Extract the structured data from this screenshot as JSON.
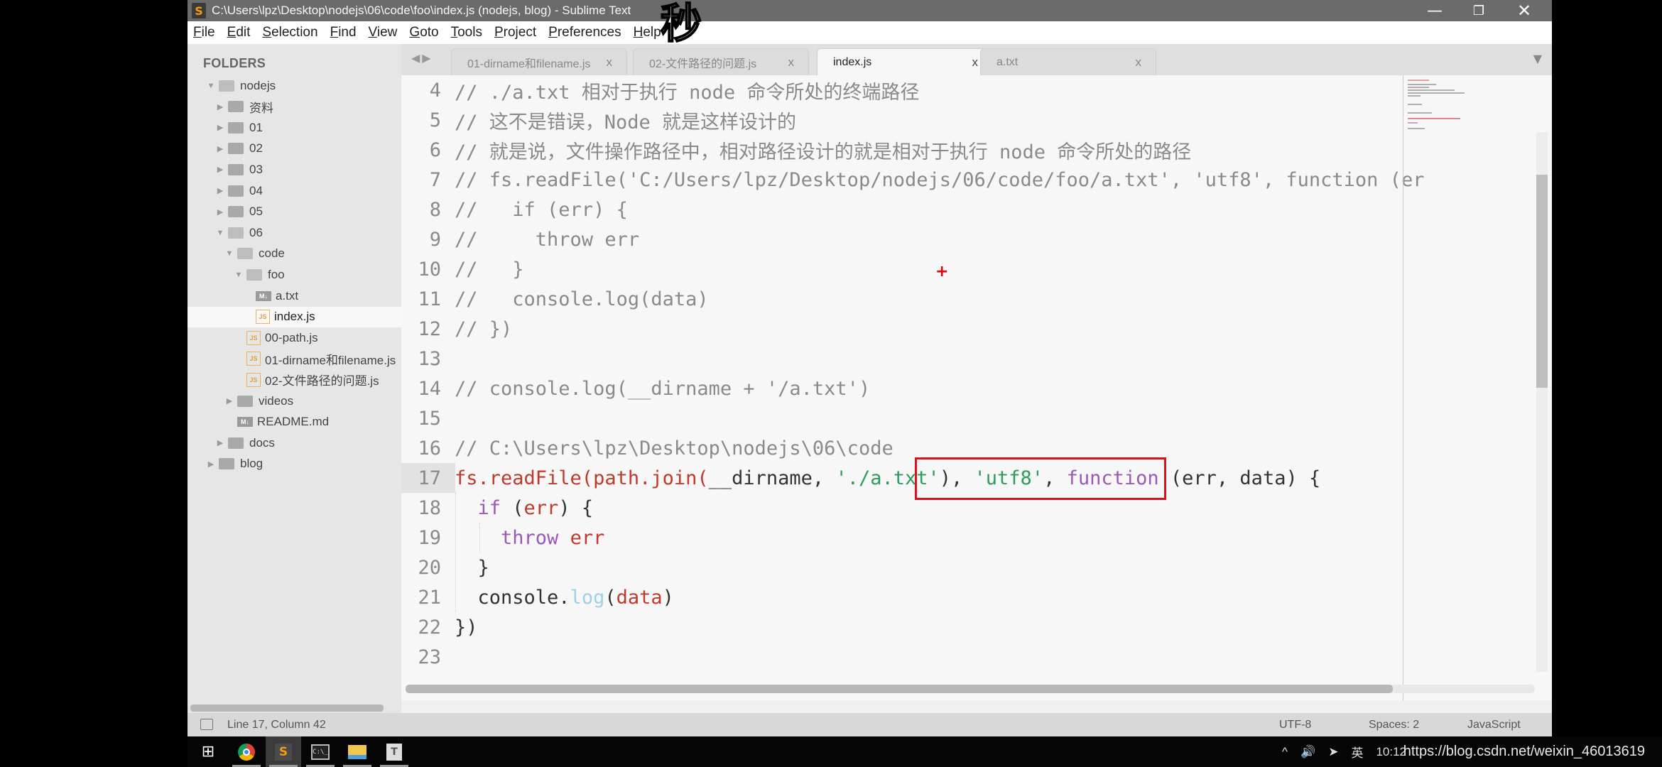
{
  "window": {
    "title": "C:\\Users\\lpz\\Desktop\\nodejs\\06\\code\\foo\\index.js (nodejs, blog) - Sublime Text",
    "controls": {
      "minimize": "—",
      "maximize": "❐",
      "close": "✕"
    }
  },
  "overlay_char": "秒",
  "menu": [
    "File",
    "Edit",
    "Selection",
    "Find",
    "View",
    "Goto",
    "Tools",
    "Project",
    "Preferences",
    "Help"
  ],
  "sidebar": {
    "header": "FOLDERS",
    "tree": [
      {
        "label": "nodejs",
        "type": "folder-open",
        "depth": 0,
        "expanded": true
      },
      {
        "label": "资料",
        "type": "folder",
        "depth": 1
      },
      {
        "label": "01",
        "type": "folder",
        "depth": 1
      },
      {
        "label": "02",
        "type": "folder",
        "depth": 1
      },
      {
        "label": "03",
        "type": "folder",
        "depth": 1
      },
      {
        "label": "04",
        "type": "folder",
        "depth": 1
      },
      {
        "label": "05",
        "type": "folder",
        "depth": 1
      },
      {
        "label": "06",
        "type": "folder-open",
        "depth": 1,
        "expanded": true
      },
      {
        "label": "code",
        "type": "folder-open",
        "depth": 2,
        "expanded": true
      },
      {
        "label": "foo",
        "type": "folder-open",
        "depth": 3,
        "expanded": true
      },
      {
        "label": "a.txt",
        "type": "md",
        "depth": 4
      },
      {
        "label": "index.js",
        "type": "js",
        "depth": 4,
        "selected": true
      },
      {
        "label": "00-path.js",
        "type": "js",
        "depth": 3
      },
      {
        "label": "01-dirname和filename.js",
        "type": "js",
        "depth": 3
      },
      {
        "label": "02-文件路径的问题.js",
        "type": "js",
        "depth": 3
      },
      {
        "label": "videos",
        "type": "folder",
        "depth": 2
      },
      {
        "label": "README.md",
        "type": "md",
        "depth": 2
      },
      {
        "label": "docs",
        "type": "folder",
        "depth": 1
      },
      {
        "label": "blog",
        "type": "folder",
        "depth": 0
      }
    ]
  },
  "tabs": [
    {
      "label": "01-dirname和filename.js",
      "close": "x",
      "active": false
    },
    {
      "label": "02-文件路径的问题.js",
      "close": "x",
      "active": false
    },
    {
      "label": "index.js",
      "close": "x",
      "active": true
    },
    {
      "label": "a.txt",
      "close": "x",
      "active": false
    }
  ],
  "tab_nav": "◀▶",
  "tab_dropdown": "▼",
  "editor": {
    "lines": [
      {
        "n": "4",
        "tokens": [
          [
            "comment",
            "// ./a.txt 相对于执行 node 命令所处的终端路径"
          ]
        ]
      },
      {
        "n": "5",
        "tokens": [
          [
            "comment",
            "// 这不是错误，Node 就是这样设计的"
          ]
        ]
      },
      {
        "n": "6",
        "tokens": [
          [
            "comment",
            "// 就是说，文件操作路径中，相对路径设计的就是相对于执行 node 命令所处的路径"
          ]
        ]
      },
      {
        "n": "7",
        "tokens": [
          [
            "comment",
            "// fs.readFile('C:/Users/lpz/Desktop/nodejs/06/code/foo/a.txt', 'utf8', function (er"
          ]
        ]
      },
      {
        "n": "8",
        "tokens": [
          [
            "comment",
            "//   if (err) {"
          ]
        ]
      },
      {
        "n": "9",
        "tokens": [
          [
            "comment",
            "//     throw err"
          ]
        ]
      },
      {
        "n": "10",
        "tokens": [
          [
            "comment",
            "//   }"
          ]
        ]
      },
      {
        "n": "11",
        "tokens": [
          [
            "comment",
            "//   console.log(data)"
          ]
        ]
      },
      {
        "n": "12",
        "tokens": [
          [
            "comment",
            "// })"
          ]
        ]
      },
      {
        "n": "13",
        "tokens": []
      },
      {
        "n": "14",
        "tokens": [
          [
            "comment",
            "// console.log(__dirname + '/a.txt')"
          ]
        ]
      },
      {
        "n": "15",
        "tokens": []
      },
      {
        "n": "16",
        "tokens": [
          [
            "comment",
            "// C:\\Users\\lpz\\Desktop\\nodejs\\06\\code"
          ]
        ]
      },
      {
        "n": "17",
        "tokens": [
          [
            "fn",
            "fs.readFile(path.join("
          ],
          [
            "plain",
            "__dirname, "
          ],
          [
            "str",
            "'./a.txt'"
          ],
          [
            "plain",
            "), "
          ],
          [
            "str",
            "'utf8'"
          ],
          [
            "plain",
            ", "
          ],
          [
            "kw",
            "function"
          ],
          [
            "plain",
            " (err, data) {"
          ]
        ]
      },
      {
        "n": "18",
        "tokens": [
          [
            "plain",
            "  "
          ],
          [
            "kw",
            "if"
          ],
          [
            "plain",
            " ("
          ],
          [
            "red",
            "err"
          ],
          [
            "plain",
            ") {"
          ]
        ]
      },
      {
        "n": "19",
        "tokens": [
          [
            "plain",
            "    "
          ],
          [
            "kw",
            "throw"
          ],
          [
            "plain",
            " "
          ],
          [
            "red",
            "err"
          ]
        ]
      },
      {
        "n": "20",
        "tokens": [
          [
            "plain",
            "  }"
          ]
        ]
      },
      {
        "n": "21",
        "tokens": [
          [
            "plain",
            "  console."
          ],
          [
            "blue",
            "log"
          ],
          [
            "plain",
            "("
          ],
          [
            "red",
            "data"
          ],
          [
            "plain",
            ")"
          ]
        ]
      },
      {
        "n": "22",
        "tokens": [
          [
            "plain",
            "})"
          ]
        ]
      },
      {
        "n": "23",
        "tokens": []
      }
    ],
    "cursor_marker": "+"
  },
  "status": {
    "position": "Line 17, Column 42",
    "encoding": "UTF-8",
    "indentation": "Spaces: 2",
    "syntax": "JavaScript"
  },
  "taskbar": {
    "start": "⊞",
    "apps": [
      "chrome-icon",
      "sublime-text-icon",
      "cmd-icon",
      "file-explorer-icon",
      "typora-icon"
    ],
    "sublime_glyph": "S",
    "cmd_glyph": "C:\\_",
    "typora_glyph": "T",
    "tray": {
      "chevron": "^",
      "volume": "🔊",
      "network": "➤",
      "ime": "英",
      "clock": "10:12"
    },
    "watermark": "https://blog.csdn.net/weixin_46013619"
  }
}
